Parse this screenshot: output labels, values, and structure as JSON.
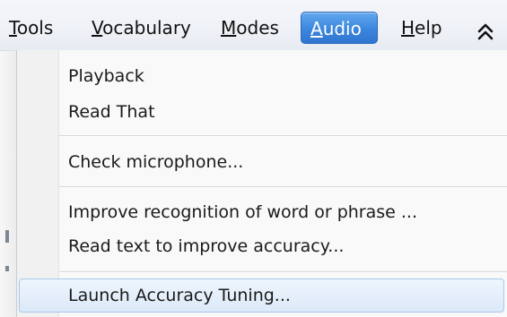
{
  "menubar": {
    "items": [
      {
        "accel": "T",
        "rest": "ools"
      },
      {
        "accel": "V",
        "rest": "ocabulary"
      },
      {
        "accel": "M",
        "rest": "odes"
      },
      {
        "accel": "A",
        "rest": "udio"
      },
      {
        "accel": "H",
        "rest": "elp"
      }
    ],
    "active_item": "Audio",
    "collapse_icon": "double-chevron-up-icon"
  },
  "dropdown": {
    "groups": [
      {
        "items": [
          "Playback",
          "Read That"
        ]
      },
      {
        "items": [
          "Check microphone..."
        ]
      },
      {
        "items": [
          "Improve recognition of word or phrase ...",
          "Read text to improve accuracy..."
        ]
      },
      {
        "items": [
          "Launch Accuracy Tuning..."
        ]
      }
    ],
    "hovered_item": "Launch Accuracy Tuning..."
  },
  "colors": {
    "active_menu_bg": "#3b86de",
    "hover_border": "#a8c9ec",
    "hover_bg": "#e4eefa"
  }
}
